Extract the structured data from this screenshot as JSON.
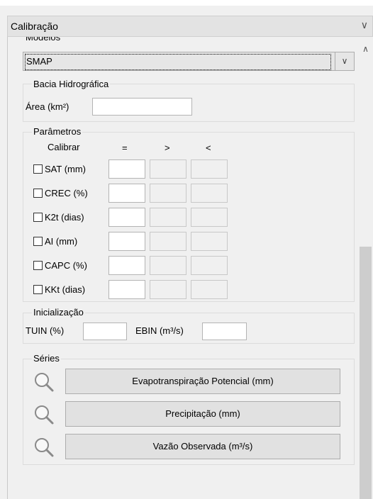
{
  "header": {
    "title": "Calibração",
    "chevron_icon": "chevron-down-icon"
  },
  "modelos": {
    "label": "Modelos",
    "selected": "SMAP"
  },
  "bacia": {
    "title": "Bacia Hidrográfica",
    "area_label": "Área (km²)",
    "area_value": ""
  },
  "parametros": {
    "title": "Parâmetros",
    "col_calibrar": "Calibrar",
    "col_eq": "=",
    "col_gt": ">",
    "col_lt": "<",
    "rows": [
      {
        "label": "SAT (mm)"
      },
      {
        "label": "CREC (%)"
      },
      {
        "label": "K2t (dias)"
      },
      {
        "label": "AI (mm)"
      },
      {
        "label": "CAPC (%)"
      },
      {
        "label": "KKt (dias)"
      }
    ]
  },
  "inicializacao": {
    "title": "Inicialização",
    "tuin_label": "TUIN (%)",
    "ebin_label": "EBIN (m³/s)"
  },
  "series": {
    "title": "Séries",
    "buttons": [
      {
        "label": "Evapotranspiração Potencial (mm)"
      },
      {
        "label": "Precipitação (mm)"
      },
      {
        "label": "Vazão Observada (m³/s)"
      }
    ]
  }
}
